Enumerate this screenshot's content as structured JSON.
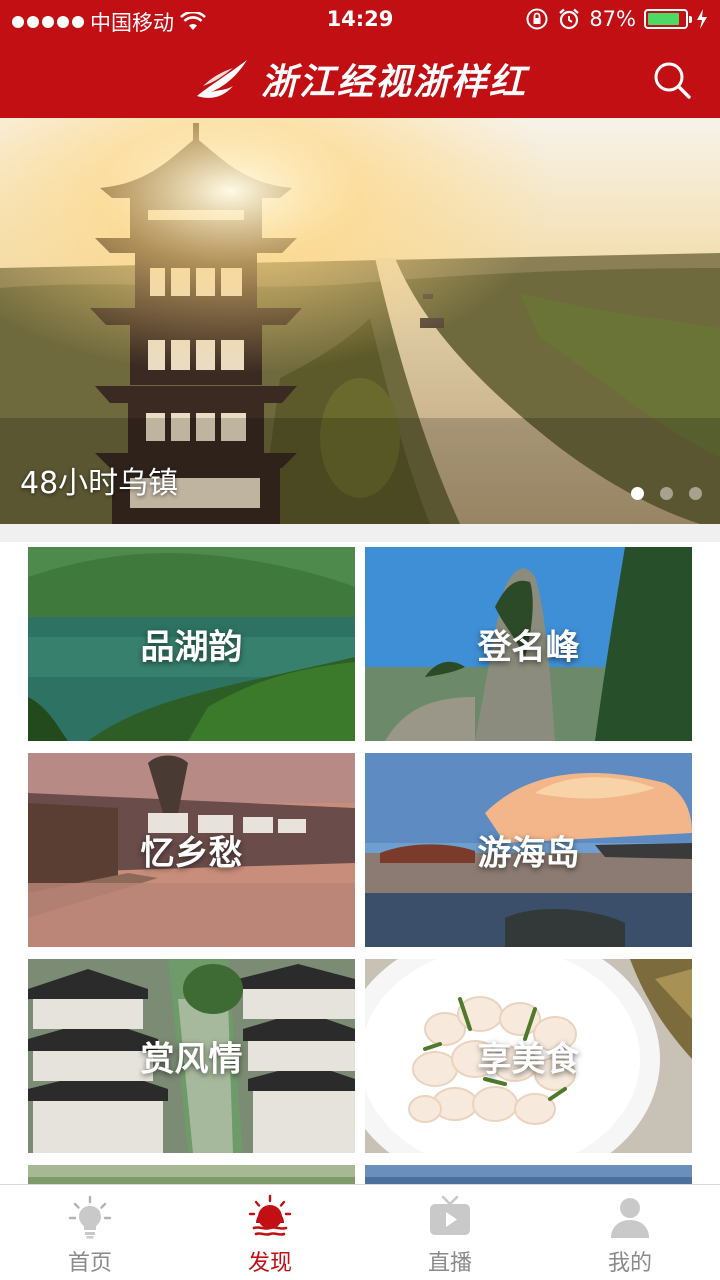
{
  "status_bar": {
    "carrier": "中国移动",
    "time": "14:29",
    "battery": "87%",
    "battery_level": 0.87,
    "icons": [
      "signal-dots-icon",
      "wifi-icon",
      "orientation-lock-icon",
      "alarm-icon",
      "battery-icon",
      "charging-icon"
    ]
  },
  "header": {
    "title": "浙江经视浙样红",
    "logo": "red-phoenix-logo",
    "search_icon": "search-icon",
    "colors": {
      "brand_red": "#c20f14"
    }
  },
  "banner": {
    "caption": "48小时乌镇",
    "slide_count": 3,
    "active_slide": 1
  },
  "categories": [
    {
      "label": "品湖韵"
    },
    {
      "label": "登名峰"
    },
    {
      "label": "忆乡愁"
    },
    {
      "label": "游海岛"
    },
    {
      "label": "赏风情"
    },
    {
      "label": "享美食"
    }
  ],
  "tabs": [
    {
      "label": "首页",
      "icon": "lightbulb-icon",
      "active": false
    },
    {
      "label": "发现",
      "icon": "sunrise-icon",
      "active": true
    },
    {
      "label": "直播",
      "icon": "tv-play-icon",
      "active": false
    },
    {
      "label": "我的",
      "icon": "user-icon",
      "active": false
    }
  ]
}
